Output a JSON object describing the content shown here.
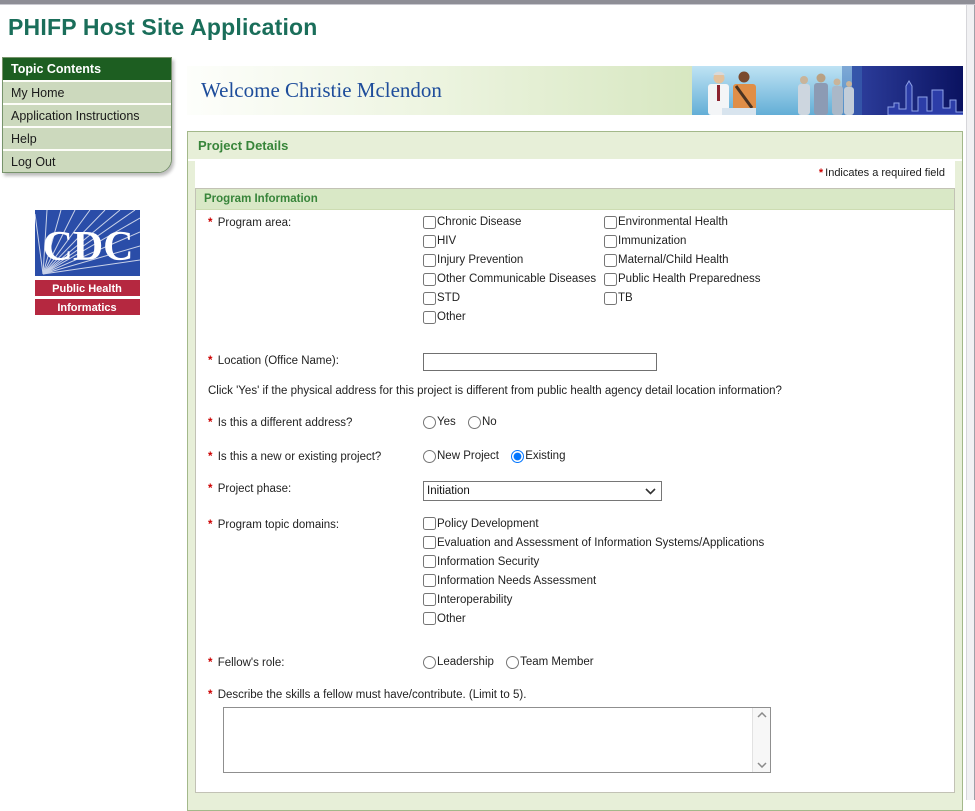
{
  "app": {
    "title": "PHIFP Host Site Application"
  },
  "required_marker": "*",
  "sidebar": {
    "header": "Topic Contents",
    "items": [
      "My Home",
      "Application Instructions",
      "Help",
      "Log Out"
    ]
  },
  "logo": {
    "acronym": "CDC",
    "line1": "Public Health",
    "line2": "Informatics"
  },
  "banner": {
    "welcome_text": "Welcome Christie Mclendon"
  },
  "page": {
    "section_title": "Project Details",
    "required_note": "Indicates a required field",
    "group_title": "Program Information"
  },
  "form": {
    "program_area": {
      "label": "Program area:",
      "col1": [
        "Chronic Disease",
        "HIV",
        "Injury Prevention",
        "Other Communicable Diseases",
        "STD",
        "Other"
      ],
      "col2": [
        "Environmental Health",
        "Immunization",
        "Maternal/Child Health",
        "Public Health Preparedness",
        "TB"
      ]
    },
    "location": {
      "label": "Location (Office Name):",
      "value": ""
    },
    "address_note": "Click 'Yes' if the physical address for this project is different from public health agency detail location information?",
    "different_address": {
      "label": "Is this a different address?",
      "options": [
        "Yes",
        "No"
      ],
      "selected": ""
    },
    "new_or_existing": {
      "label": "Is this a new or existing project?",
      "options": [
        "New Project",
        "Existing"
      ],
      "selected": "Existing"
    },
    "project_phase": {
      "label": "Project phase:",
      "value": "Initiation"
    },
    "topic_domains": {
      "label": "Program topic domains:",
      "options": [
        "Policy Development",
        "Evaluation and Assessment of Information Systems/Applications",
        "Information Security",
        "Information Needs Assessment",
        "Interoperability",
        "Other"
      ]
    },
    "fellows_role": {
      "label": "Fellow's role:",
      "options": [
        "Leadership",
        "Team Member"
      ],
      "selected": ""
    },
    "skills": {
      "label": "Describe the skills a fellow must have/contribute. (Limit to 5).",
      "value": ""
    }
  },
  "colors": {
    "title_green": "#1a6e5a",
    "sidebar_header_bg": "#1d5e21",
    "sidebar_item_bg": "#ccd9bd",
    "panel_bg": "#e7efd8",
    "section_text": "#38853a",
    "group_header_bg": "#d9e8c6",
    "required_red": "#cc0000",
    "cdc_blue": "#2a4da8",
    "cdc_red": "#b52840",
    "welcome_blue": "#1e4d9b"
  }
}
